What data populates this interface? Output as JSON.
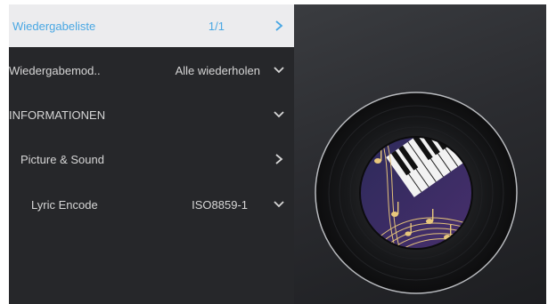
{
  "menu": {
    "items": [
      {
        "label": "Wiedergabeliste",
        "value": "1/1",
        "chevron": "chevron-right"
      },
      {
        "label": "Wiedergabemod..",
        "value": "Alle wiederholen",
        "chevron": "chevron-down"
      },
      {
        "label": "INFORMATIONEN",
        "value": "",
        "chevron": "chevron-down"
      },
      {
        "label": "Picture & Sound",
        "value": "",
        "chevron": "chevron-right"
      },
      {
        "label": "Lyric Encode",
        "value": "ISO8859-1",
        "chevron": "chevron-down"
      }
    ],
    "selected_index": 0
  },
  "colors": {
    "selected_text": "#49a7e3",
    "panel_bg": "#26272a",
    "text": "#d6d6d6"
  },
  "album_art": {
    "icon": "vinyl-record-with-piano-and-music-notes"
  }
}
